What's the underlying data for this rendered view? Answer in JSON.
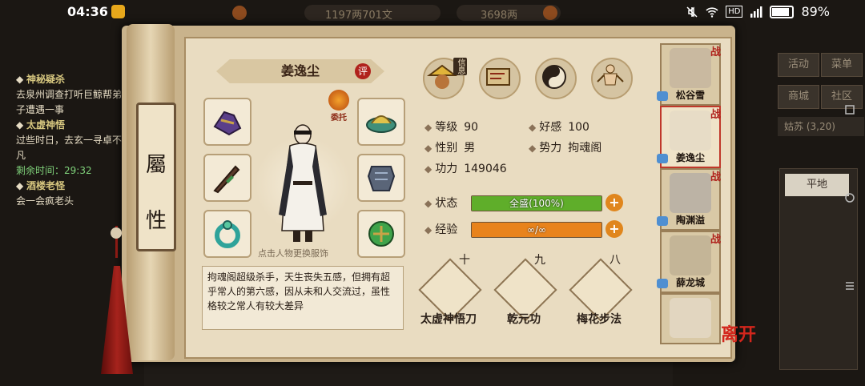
{
  "status_bar": {
    "time": "04:36",
    "battery": "89%",
    "hd_label": "HD"
  },
  "background": {
    "top_currency_1": "1197两701文",
    "top_currency_2": "3698两",
    "quests": [
      {
        "title": "神秘疑杀",
        "body": "去泉州调查打听巨鲸帮弟子遭遇一事"
      },
      {
        "title": "太虚神悟",
        "body": "过些时日，去玄一寻卓不凡"
      },
      {
        "title": "",
        "body": "剩余时间：29:32"
      },
      {
        "title": "酒楼老怪",
        "body": "会一会疯老头"
      }
    ],
    "right_buttons": [
      "活动",
      "菜单",
      "商城",
      "社区"
    ],
    "location": "姑苏",
    "location_coords": "(3,20)",
    "terrain": "平地"
  },
  "scroll_title": [
    "屬",
    "性"
  ],
  "character": {
    "name": "姜逸尘",
    "rate_badge": "评",
    "delegate_label": "委托",
    "change_hint": "点击人物更换服饰",
    "bio": "拘魂阁超级杀手，天生丧失五感，但拥有超乎常人的第六感，因从未和人交流过，虽性格较之常人有较大差异"
  },
  "equipment": [
    {
      "slot": "gloves",
      "icon": "gloves-icon"
    },
    {
      "slot": "hat",
      "icon": "hat-icon"
    },
    {
      "slot": "weapon",
      "icon": "sword-icon"
    },
    {
      "slot": "armor",
      "icon": "armor-icon"
    },
    {
      "slot": "ring",
      "icon": "ring-icon"
    },
    {
      "slot": "jade",
      "icon": "jade-icon"
    }
  ],
  "tabs": [
    {
      "name": "info",
      "label": "信息",
      "icon": "hat-man-icon",
      "active": true
    },
    {
      "name": "map",
      "icon": "scroll-map-icon"
    },
    {
      "name": "taiji",
      "icon": "bagua-icon"
    },
    {
      "name": "body",
      "icon": "meridian-figure-icon"
    }
  ],
  "stats": {
    "level_label": "等级",
    "level": "90",
    "affinity_label": "好感",
    "affinity": "100",
    "gender_label": "性别",
    "gender": "男",
    "faction_label": "势力",
    "faction": "拘魂阁",
    "power_label": "功力",
    "power": "149046"
  },
  "bars": {
    "status_label": "状态",
    "status_text": "全盛(100%)",
    "status_fill": 1.0,
    "exp_label": "经验",
    "exp_text": "∞/∞",
    "exp_fill": 1.0
  },
  "skills": [
    {
      "level": "十",
      "name": "太虚神悟刀",
      "icon": "book-icon"
    },
    {
      "level": "九",
      "name": "乾元功",
      "icon": "scroll-icon"
    },
    {
      "level": "八",
      "name": "梅花步法",
      "icon": "manual-icon"
    }
  ],
  "roster": [
    {
      "name": "松谷雪",
      "tag": "战",
      "selected": false
    },
    {
      "name": "姜逸尘",
      "tag": "战",
      "selected": true
    },
    {
      "name": "陶渊溢",
      "tag": "战",
      "selected": false
    },
    {
      "name": "薛龙城",
      "tag": "战",
      "selected": false
    },
    {
      "name": "",
      "tag": "",
      "selected": false
    }
  ],
  "leave_label": "离开",
  "colors": {
    "status_bar_fill": "#5fae2a",
    "exp_bar_fill": "#e8831c",
    "accent_red": "#b0221c"
  }
}
